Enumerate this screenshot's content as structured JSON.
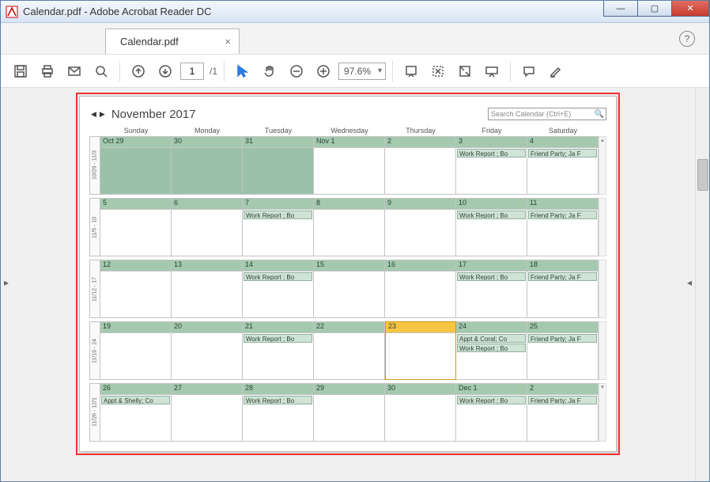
{
  "window": {
    "title": "Calendar.pdf - Adobe Acrobat Reader DC",
    "min_label": "—",
    "max_label": "▢",
    "close_label": "✕"
  },
  "tabs": {
    "home_label": "",
    "doc_label": "Calendar.pdf"
  },
  "toolbar": {
    "page_current": "1",
    "page_total": "/1",
    "zoom_value": "97.6%"
  },
  "calendar": {
    "title": "November 2017",
    "search_placeholder": "Search Calendar (Ctrl+E)",
    "days_of_week": [
      "Sunday",
      "Monday",
      "Tuesday",
      "Wednesday",
      "Thursday",
      "Friday",
      "Saturday"
    ],
    "weeks": [
      {
        "label": "10/29 - 11/3",
        "days": [
          {
            "num": "Oct 29",
            "past": true,
            "events": []
          },
          {
            "num": "30",
            "past": true,
            "events": []
          },
          {
            "num": "31",
            "past": true,
            "events": []
          },
          {
            "num": "Nov 1",
            "events": []
          },
          {
            "num": "2",
            "events": []
          },
          {
            "num": "3",
            "events": [
              "Work Report ; Bo"
            ]
          },
          {
            "num": "4",
            "events": [
              "Friend Party; Ja F"
            ]
          }
        ]
      },
      {
        "label": "11/5 - 10",
        "days": [
          {
            "num": "5",
            "events": []
          },
          {
            "num": "6",
            "events": []
          },
          {
            "num": "7",
            "events": [
              "Work Report ; Bo"
            ]
          },
          {
            "num": "8",
            "events": []
          },
          {
            "num": "9",
            "events": []
          },
          {
            "num": "10",
            "events": [
              "Work Report ; Bo"
            ]
          },
          {
            "num": "11",
            "events": [
              "Friend Party; Ja F"
            ]
          }
        ]
      },
      {
        "label": "11/12 - 17",
        "days": [
          {
            "num": "12",
            "events": []
          },
          {
            "num": "13",
            "events": []
          },
          {
            "num": "14",
            "events": [
              "Work Report ; Bo"
            ]
          },
          {
            "num": "15",
            "events": []
          },
          {
            "num": "16",
            "events": []
          },
          {
            "num": "17",
            "events": [
              "Work Report ; Bo"
            ]
          },
          {
            "num": "18",
            "events": [
              "Friend Party; Ja F"
            ]
          }
        ]
      },
      {
        "label": "11/19 - 24",
        "days": [
          {
            "num": "19",
            "events": []
          },
          {
            "num": "20",
            "events": []
          },
          {
            "num": "21",
            "events": [
              "Work Report ; Bo"
            ]
          },
          {
            "num": "22",
            "events": []
          },
          {
            "num": "23",
            "today": true,
            "events": []
          },
          {
            "num": "24",
            "events": [
              "Appt & Coral; Co",
              "Work Report ; Bo"
            ]
          },
          {
            "num": "25",
            "events": [
              "Friend Party; Ja F"
            ]
          }
        ]
      },
      {
        "label": "11/26 - 12/1",
        "days": [
          {
            "num": "26",
            "events": [
              "Appt & Shelly; Co"
            ]
          },
          {
            "num": "27",
            "events": []
          },
          {
            "num": "28",
            "events": [
              "Work Report ; Bo"
            ]
          },
          {
            "num": "29",
            "events": []
          },
          {
            "num": "30",
            "events": []
          },
          {
            "num": "Dec 1",
            "events": [
              "Work Report ; Bo"
            ]
          },
          {
            "num": "2",
            "events": [
              "Friend Party; Ja F"
            ]
          }
        ]
      }
    ]
  }
}
